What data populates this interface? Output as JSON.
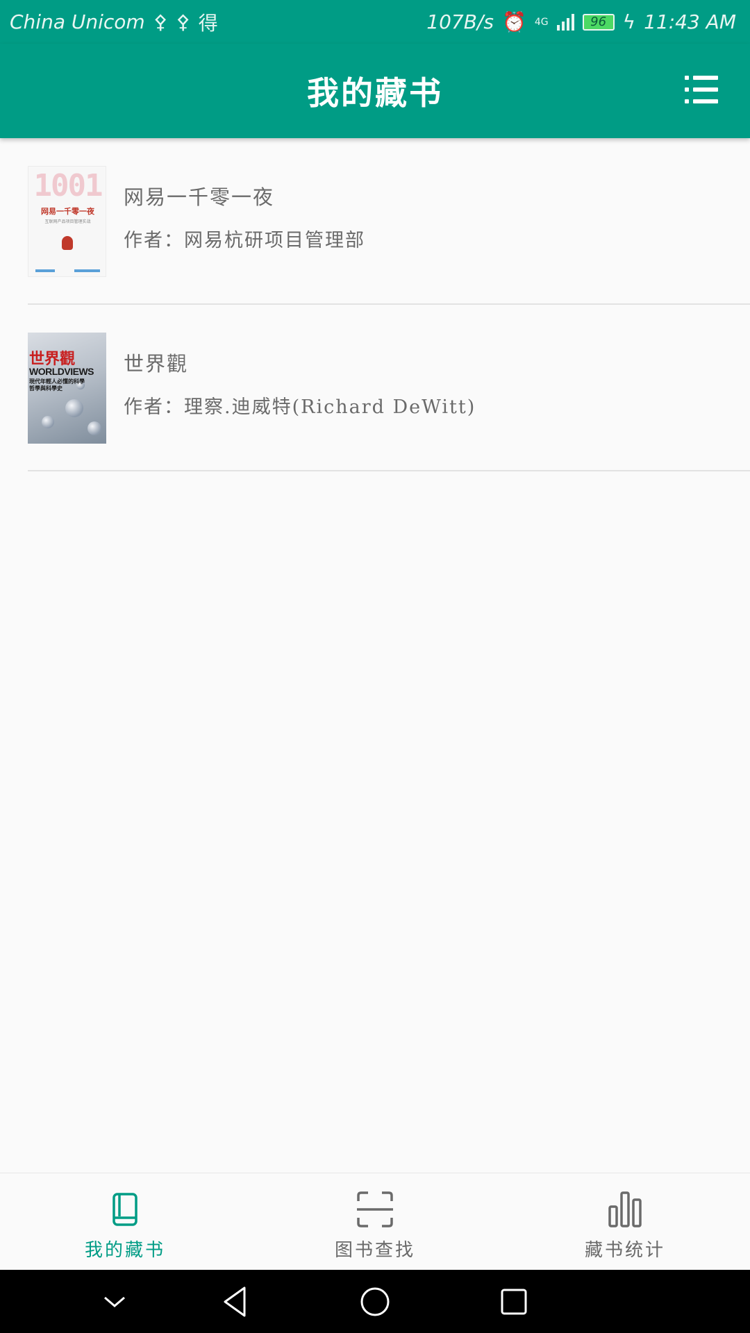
{
  "status_bar": {
    "carrier": "China Unicom",
    "carrier_icons": [
      "usb-icon",
      "usb-icon",
      "de-app-icon"
    ],
    "de_glyph": "得",
    "net_speed": "107B/s",
    "network_type": "4G",
    "battery_level": "96",
    "time": "11:43 AM"
  },
  "app_bar": {
    "title": "我的藏书",
    "menu_icon": "list-menu-icon"
  },
  "books": [
    {
      "title": "网易一千零一夜",
      "author_label": "作者：",
      "author": "网易杭研项目管理部",
      "cover": {
        "big_text": "1001",
        "title_text": "网易一千零一夜",
        "subtitle_text": "互联网产品项目管理实战"
      }
    },
    {
      "title": "世界觀",
      "author_label": "作者：",
      "author": "理察.迪威特(Richard DeWitt)",
      "cover": {
        "title_text": "世界觀",
        "english_text": "WORLDVIEWS",
        "subtitle_text": "現代年輕人必懂的科學哲學與科學史"
      }
    }
  ],
  "bottom_nav": [
    {
      "label": "我的藏书",
      "icon": "book-icon",
      "active": true
    },
    {
      "label": "图书查找",
      "icon": "scan-icon",
      "active": false
    },
    {
      "label": "藏书统计",
      "icon": "bar-chart-icon",
      "active": false
    }
  ],
  "colors": {
    "primary": "#009c85",
    "text_secondary": "#6a6a6a",
    "background": "#fafafa"
  }
}
